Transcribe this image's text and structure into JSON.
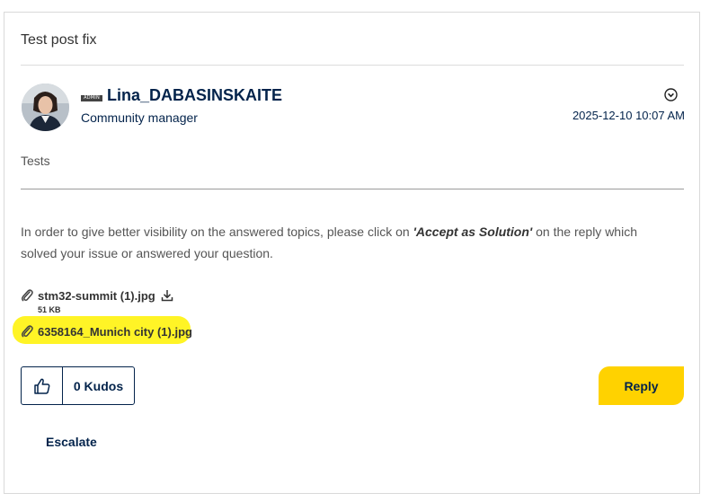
{
  "post": {
    "title": "Test post fix",
    "author": {
      "badge": "ADMIN",
      "name": "Lina_DABASINSKAITE",
      "role": "Community manager",
      "avatar_icon": "user-photo"
    },
    "timestamp": "2025-12-10 10:07 AM",
    "body": "Tests",
    "notice": {
      "before": "In order to give better visibility on the answered topics, please click on ",
      "emphasis": "'Accept as Solution'",
      "after": " on the reply which solved your issue or answered your question."
    },
    "attachments": [
      {
        "name": "stm32-summit (1).jpg",
        "size": "51 KB",
        "icon": "paperclip-icon"
      },
      {
        "name": "6358164_Munich city (1).jpg",
        "icon": "paperclip-icon"
      }
    ]
  },
  "actions": {
    "kudos_label": "0 Kudos",
    "reply_label": "Reply",
    "escalate_label": "Escalate"
  },
  "colors": {
    "brand_navy": "#03234b",
    "reply_yellow": "#ffd200",
    "highlight": "#fff200"
  }
}
